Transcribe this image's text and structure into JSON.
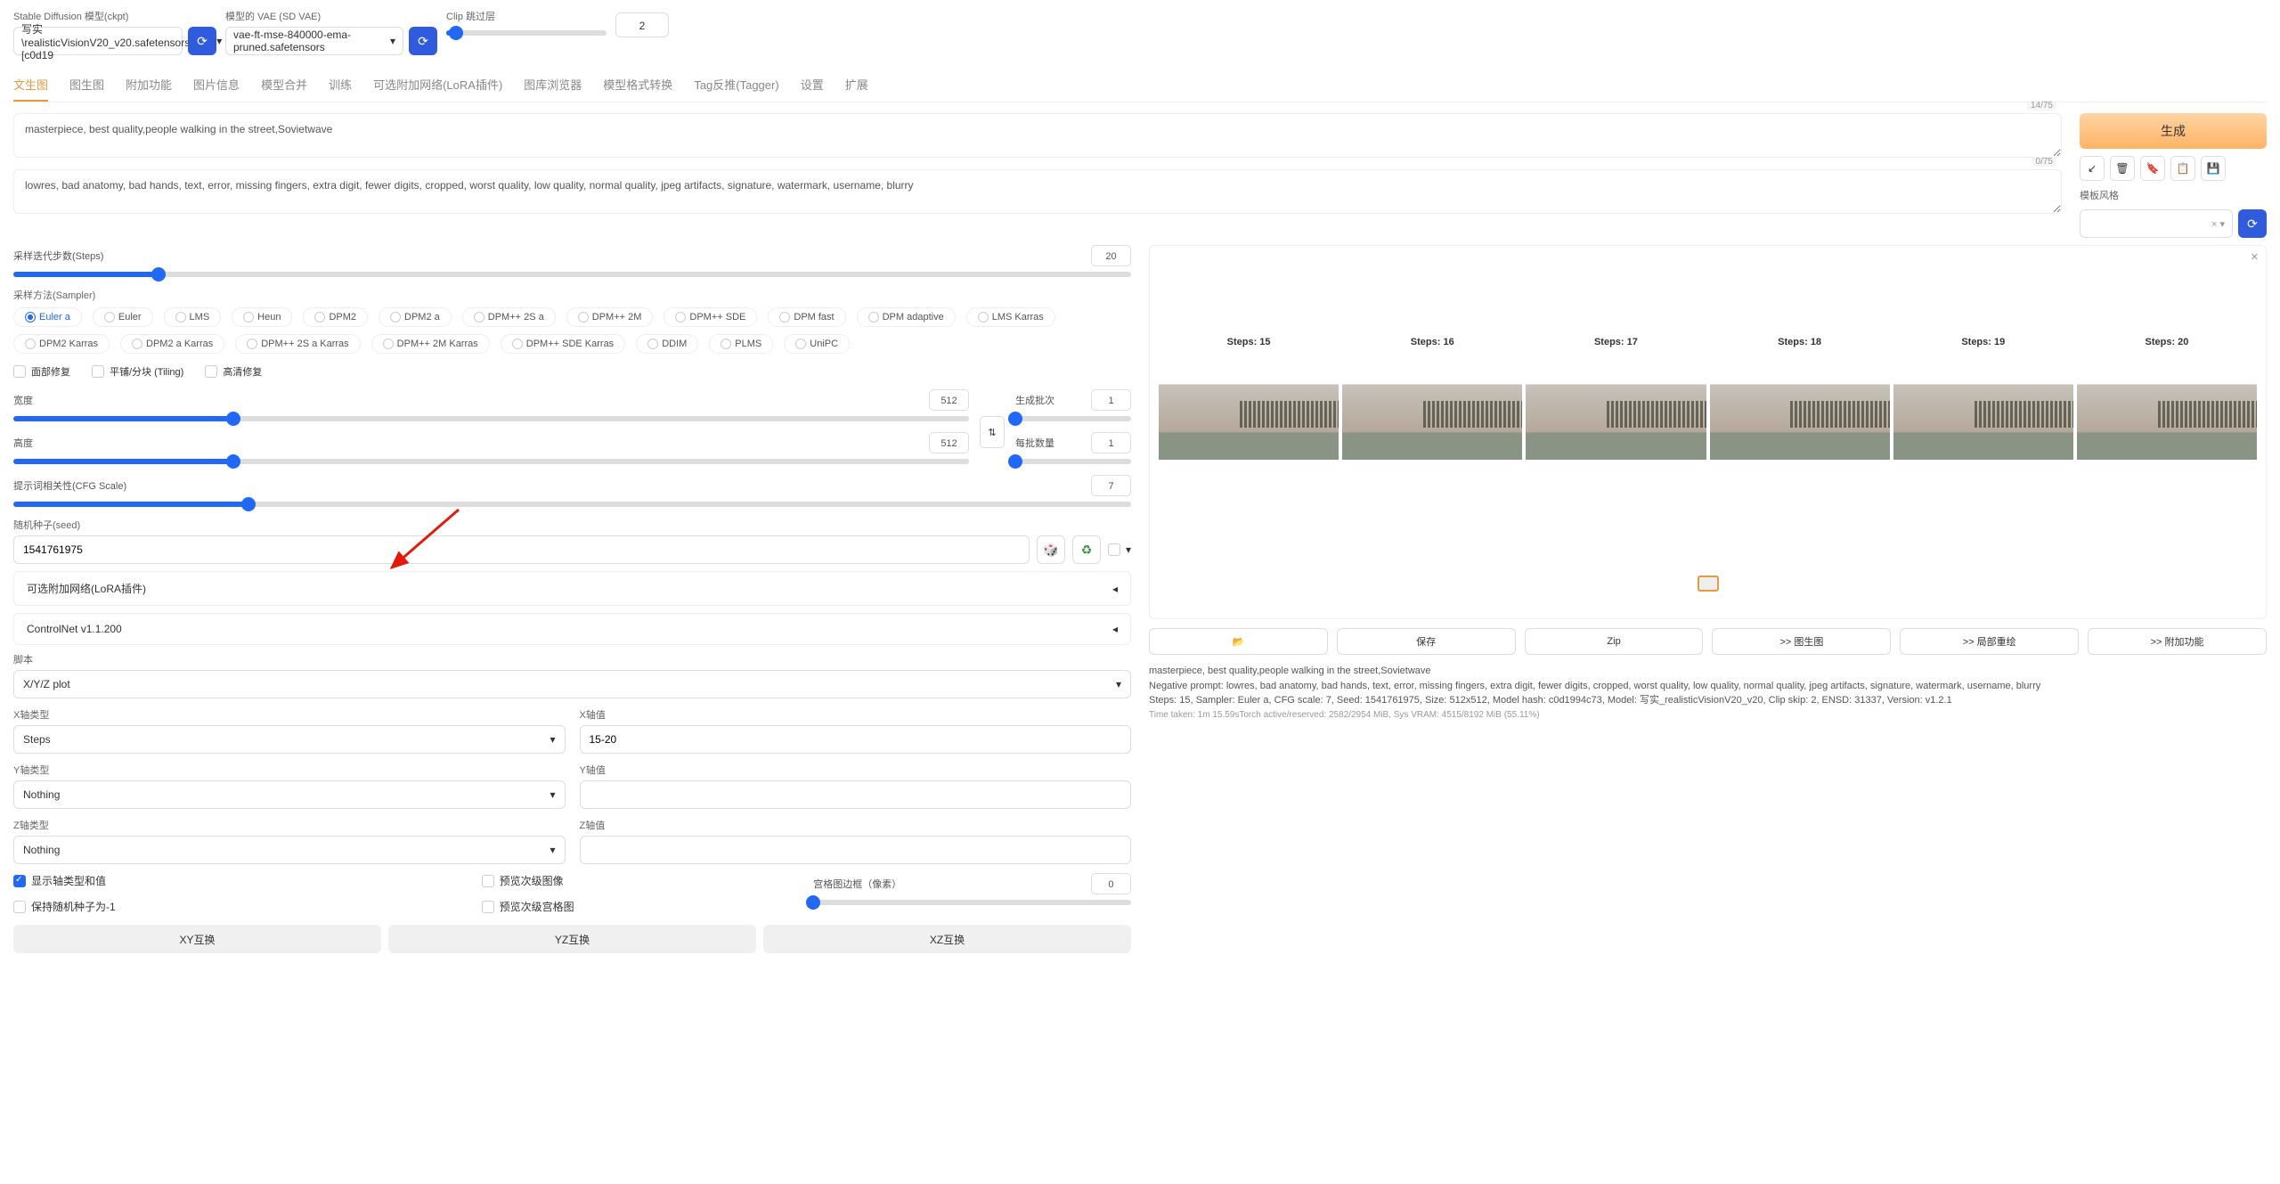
{
  "top": {
    "ckpt_label": "Stable Diffusion 模型(ckpt)",
    "ckpt_value": "写实\\realisticVisionV20_v20.safetensors [c0d19",
    "vae_label": "模型的 VAE (SD VAE)",
    "vae_value": "vae-ft-mse-840000-ema-pruned.safetensors",
    "clip_label": "Clip 跳过层",
    "clip_value": "2"
  },
  "tabs": [
    "文生图",
    "图生图",
    "附加功能",
    "图片信息",
    "模型合并",
    "训练",
    "可选附加网络(LoRA插件)",
    "图库浏览器",
    "模型格式转换",
    "Tag反推(Tagger)",
    "设置",
    "扩展"
  ],
  "prompts": {
    "pos": "masterpiece, best quality,people walking in the street,Sovietwave",
    "pos_count": "14/75",
    "neg": "lowres, bad anatomy, bad hands, text, error, missing fingers, extra digit, fewer digits, cropped, worst quality, low quality, normal quality, jpeg artifacts, signature, watermark, username, blurry",
    "neg_count": "0/75"
  },
  "generate": "生成",
  "style_label": "模板风格",
  "sampler": {
    "steps_label": "采样迭代步数(Steps)",
    "steps": "20",
    "method_label": "采样方法(Sampler)",
    "methods": [
      "Euler a",
      "Euler",
      "LMS",
      "Heun",
      "DPM2",
      "DPM2 a",
      "DPM++ 2S a",
      "DPM++ 2M",
      "DPM++ SDE",
      "DPM fast",
      "DPM adaptive",
      "LMS Karras",
      "DPM2 Karras",
      "DPM2 a Karras",
      "DPM++ 2S a Karras",
      "DPM++ 2M Karras",
      "DPM++ SDE Karras",
      "DDIM",
      "PLMS",
      "UniPC"
    ]
  },
  "checks": {
    "face": "面部修复",
    "tile": "平铺/分块 (Tiling)",
    "hires": "高清修复"
  },
  "dims": {
    "width_label": "宽度",
    "width": "512",
    "height_label": "高度",
    "height": "512",
    "batch_count_label": "生成批次",
    "batch_count": "1",
    "batch_size_label": "每批数量",
    "batch_size": "1"
  },
  "cfg": {
    "label": "提示词相关性(CFG Scale)",
    "value": "7"
  },
  "seed": {
    "label": "随机种子(seed)",
    "value": "1541761975"
  },
  "accordions": {
    "lora": "可选附加网络(LoRA插件)",
    "controlnet": "ControlNet v1.1.200"
  },
  "script": {
    "label": "脚本",
    "value": "X/Y/Z plot"
  },
  "xyz": {
    "x_type_label": "X轴类型",
    "x_type": "Steps",
    "x_val_label": "X轴值",
    "x_val": "15-20",
    "y_type_label": "Y轴类型",
    "y_type": "Nothing",
    "y_val_label": "Y轴值",
    "y_val": "",
    "z_type_label": "Z轴类型",
    "z_type": "Nothing",
    "z_val_label": "Z轴值",
    "z_val": ""
  },
  "xyz_opts": {
    "legend": "显示轴类型和值",
    "keep_seed": "保持随机种子为-1",
    "sub_img": "预览次级图像",
    "sub_grid": "预览次级宫格图",
    "margin_label": "宫格图边框（像素）",
    "margin": "0",
    "swap_xy": "XY互换",
    "swap_yz": "YZ互换",
    "swap_xz": "XZ互换"
  },
  "output": {
    "img_labels": [
      "Steps: 15",
      "Steps: 16",
      "Steps: 17",
      "Steps: 18",
      "Steps: 19",
      "Steps: 20"
    ],
    "btn_save": "保存",
    "btn_zip": "Zip",
    "btn_i2i": ">> 图生图",
    "btn_inpaint": ">> 局部重绘",
    "btn_extras": ">> 附加功能",
    "info1": "masterpiece, best quality,people walking in the street,Sovietwave",
    "info2": "Negative prompt: lowres, bad anatomy, bad hands, text, error, missing fingers, extra digit, fewer digits, cropped, worst quality, low quality, normal quality, jpeg artifacts, signature, watermark, username, blurry",
    "info3": "Steps: 15, Sampler: Euler a, CFG scale: 7, Seed: 1541761975, Size: 512x512, Model hash: c0d1994c73, Model: 写实_realisticVisionV20_v20, Clip skip: 2, ENSD: 31337, Version: v1.2.1",
    "info4": "Time taken: 1m 15.59sTorch active/reserved: 2582/2954 MiB, Sys VRAM: 4515/8192 MiB (55.11%)"
  }
}
